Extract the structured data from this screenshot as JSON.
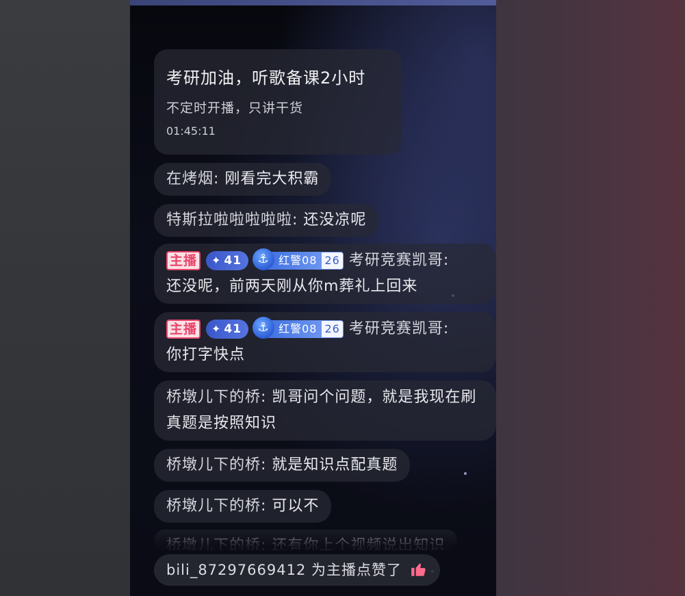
{
  "stream_header": {
    "title": "考研加油，听歌备课2小时",
    "subtitle": "不定时开播，只讲干货",
    "duration": "01:45:11"
  },
  "comments": [
    {
      "user": "在烤烟",
      "text": "刚看完大积霸"
    },
    {
      "user": "特斯拉啦啦啦啦啦",
      "text": "还没凉呢"
    },
    {
      "user": "考研竞赛凯哥",
      "text": "还没呢，前两天刚从你m葬礼上回来",
      "host_badge": "主播",
      "level": "41",
      "fan_medal": "红警08",
      "fan_level": "26"
    },
    {
      "user": "考研竞赛凯哥",
      "text": "你打字快点",
      "host_badge": "主播",
      "level": "41",
      "fan_medal": "红警08",
      "fan_level": "26"
    },
    {
      "user": "桥墩儿下的桥",
      "text": "凯哥问个问题，就是我现在刷真题是按照知识"
    },
    {
      "user": "桥墩儿下的桥",
      "text": "就是知识点配真题"
    },
    {
      "user": "桥墩儿下的桥",
      "text": "可以不"
    },
    {
      "user": "桥墩儿下的桥",
      "text": "还有你上个视频说出知识"
    }
  ],
  "like_notice": {
    "user": "bili_87297669412",
    "text": "为主播点赞了",
    "icon": "thumbs-up-icon"
  },
  "colors": {
    "host_badge": "#e8456a",
    "level_badge": "#3a57c8",
    "fan_medal": "#3f6fe0",
    "like_icon": "#ff6b8a"
  }
}
